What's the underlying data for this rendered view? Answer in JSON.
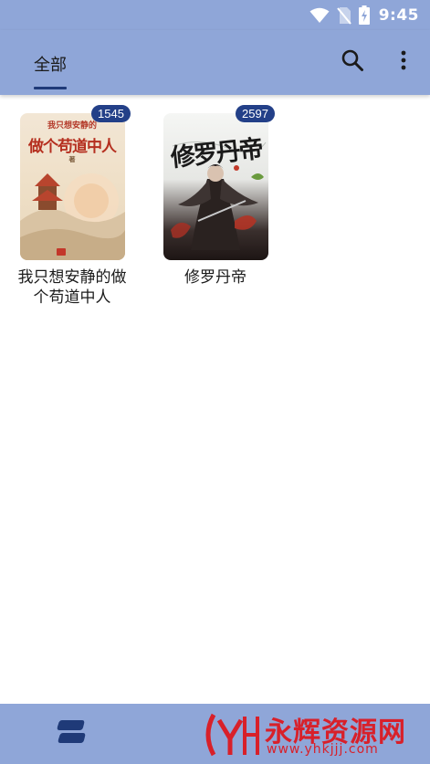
{
  "status_bar": {
    "time": "9:45",
    "icons": [
      "wifi-icon",
      "no-sim-icon",
      "battery-charging-icon"
    ]
  },
  "toolbar": {
    "tab_label": "全部",
    "actions": [
      "search-icon",
      "more-vert-icon"
    ]
  },
  "books": [
    {
      "title": "我只想安静的做个苟道中人",
      "unread": "1545",
      "cover_top": "我只想安静的",
      "cover_main": "做个苟道中人",
      "cover_author": "著"
    },
    {
      "title": "修罗丹帝",
      "unread": "2597",
      "cover_main": "修罗丹帝"
    }
  ],
  "bottom_bar": {
    "nav_icon": "bookshelf-nav-icon"
  },
  "watermark": {
    "brand": "永辉资源网",
    "url": "www.yhkjjj.com"
  },
  "colors": {
    "accent_bar": "#8fa6d8",
    "badge": "#234088",
    "indicator": "#1f3a78",
    "watermark": "#d8202a"
  }
}
